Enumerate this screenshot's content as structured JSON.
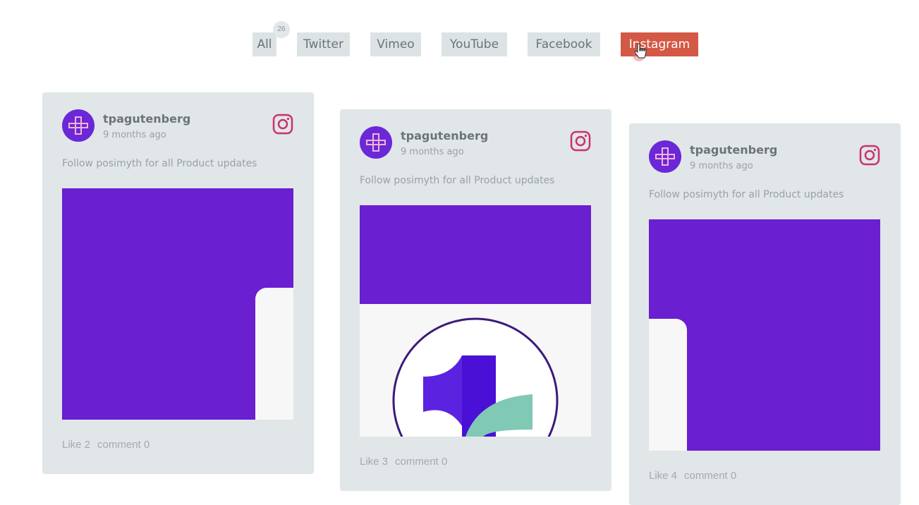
{
  "filters": {
    "count": "26",
    "items": [
      {
        "label": "All"
      },
      {
        "label": "Twitter"
      },
      {
        "label": "Vimeo"
      },
      {
        "label": "YouTube"
      },
      {
        "label": "Facebook"
      },
      {
        "label": "Instagram",
        "active": true
      }
    ],
    "active_color": "#d35845"
  },
  "cards": [
    {
      "username": "tpagutenberg",
      "time": "9 months ago",
      "caption": "Follow posimyth for all Product updates",
      "likes": "Like 2",
      "comments": "comment 0",
      "network_icon": "instagram-icon"
    },
    {
      "username": "tpagutenberg",
      "time": "9 months ago",
      "caption": "Follow posimyth for all Product updates",
      "likes": "Like 3",
      "comments": "comment 0",
      "network_icon": "instagram-icon"
    },
    {
      "username": "tpagutenberg",
      "time": "9 months ago",
      "caption": "Follow posimyth for all Product updates",
      "likes": "Like 4",
      "comments": "comment 0",
      "network_icon": "instagram-icon"
    }
  ],
  "colors": {
    "brand_purple": "#6a1fd0",
    "card_bg": "#e1e6e8",
    "instagram": "#c8336b",
    "teal": "#7fc9b5"
  }
}
